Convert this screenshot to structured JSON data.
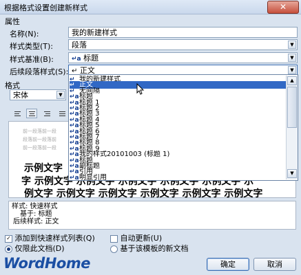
{
  "window": {
    "title": "根据格式设置创建新样式",
    "close_symbol": "✕"
  },
  "properties": {
    "section_label": "属性",
    "name_label": "名称(N):",
    "name_value": "我的新建样式",
    "type_label": "样式类型(T):",
    "type_value": "段落",
    "based_on_label": "样式基准(B):",
    "based_on_value": "标题",
    "based_on_icon": "↵a",
    "following_label": "后续段落样式(S):",
    "following_value": "正文",
    "following_icon": "↵"
  },
  "format": {
    "section_label": "格式",
    "font_value": "宋体"
  },
  "dropdown_list": [
    {
      "icon": "↵",
      "text": "我的新建样式",
      "selected": false
    },
    {
      "icon": "↵",
      "text": "正文",
      "selected": true
    },
    {
      "icon": "↵",
      "text": "无间隔",
      "selected": false
    },
    {
      "icon": "↵a",
      "text": "标题",
      "selected": false
    },
    {
      "icon": "↵a",
      "text": "标题 1",
      "selected": false
    },
    {
      "icon": "↵a",
      "text": "标题 2",
      "selected": false
    },
    {
      "icon": "↵a",
      "text": "标题 3",
      "selected": false
    },
    {
      "icon": "↵a",
      "text": "标题 4",
      "selected": false
    },
    {
      "icon": "↵a",
      "text": "标题 5",
      "selected": false
    },
    {
      "icon": "↵a",
      "text": "标题 6",
      "selected": false
    },
    {
      "icon": "↵a",
      "text": "标题 7",
      "selected": false
    },
    {
      "icon": "↵a",
      "text": "标题 8",
      "selected": false
    },
    {
      "icon": "↵a",
      "text": "标题 9",
      "selected": false
    },
    {
      "icon": "↵a",
      "text": "我的样式20101003  (标题 1)",
      "selected": false
    },
    {
      "icon": "↵a",
      "text": "标题",
      "selected": false
    },
    {
      "icon": "↵a",
      "text": "副标题",
      "selected": false
    },
    {
      "icon": "↵a",
      "text": "引用",
      "selected": false
    },
    {
      "icon": "↵a",
      "text": "明显引用",
      "selected": false
    }
  ],
  "preview": {
    "prev_para_1": "前一段落前一段",
    "prev_para_2": "段落前一段落前",
    "prev_para_3": "前一段落前一段",
    "sample_line_1": "示例文字",
    "sample_line_2": "字 示例文字 示例文字 示例文字 示例文字 示例文字 示",
    "sample_line_3": "例文字 示例文字 示例文字 示例文字 示例文字 示例文字"
  },
  "description": {
    "line1": "样式: 快速样式",
    "line2": "基于: 标题",
    "line3": "后续样式: 正文"
  },
  "options": {
    "add_to_quick_label": "添加到快速样式列表(Q)",
    "add_to_quick_checked": true,
    "auto_update_label": "自动更新(U)",
    "auto_update_checked": false,
    "this_doc_label": "仅限此文档(D)",
    "template_label": "基于该模板的新文档",
    "check_mark": "✓"
  },
  "buttons": {
    "ok": "确定",
    "cancel": "取消"
  },
  "watermark": "WordHome"
}
